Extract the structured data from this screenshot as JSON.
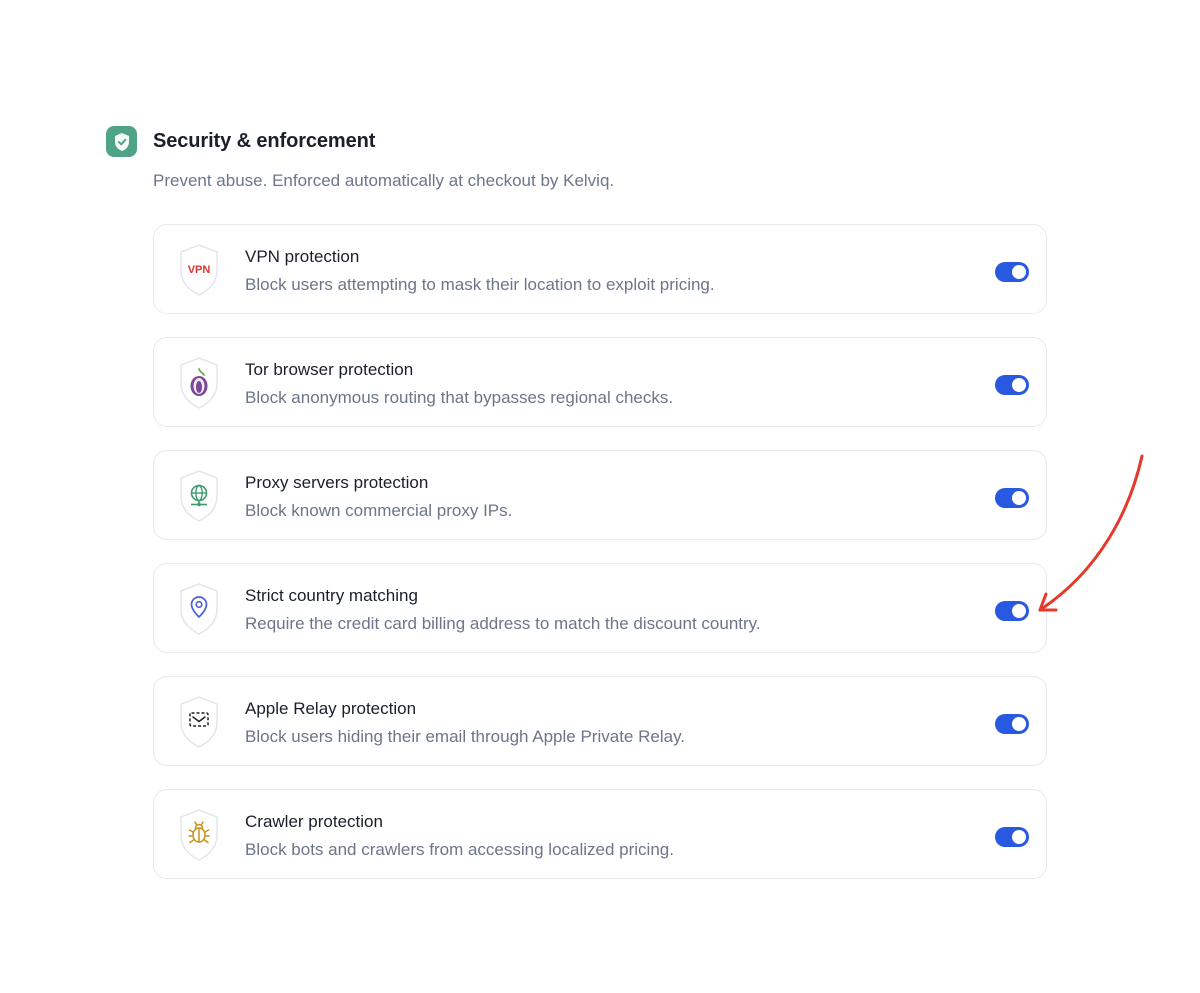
{
  "section": {
    "title": "Security & enforcement",
    "subtitle": "Prevent abuse. Enforced automatically at checkout by Kelviq.",
    "icon": "shield-check-icon"
  },
  "items": [
    {
      "title": "VPN protection",
      "description": "Block users attempting to mask their location to exploit pricing.",
      "icon": "vpn-shield-icon",
      "icon_text": "VPN",
      "enabled": true
    },
    {
      "title": "Tor browser protection",
      "description": "Block anonymous routing that bypasses regional checks.",
      "icon": "tor-onion-icon",
      "enabled": true
    },
    {
      "title": "Proxy servers protection",
      "description": "Block known commercial proxy IPs.",
      "icon": "globe-network-icon",
      "enabled": true
    },
    {
      "title": "Strict country matching",
      "description": "Require the credit card billing address to match the discount country.",
      "icon": "location-pin-icon",
      "enabled": true
    },
    {
      "title": "Apple Relay protection",
      "description": "Block users hiding their email through Apple Private Relay.",
      "icon": "hidden-mail-icon",
      "enabled": true
    },
    {
      "title": "Crawler protection",
      "description": "Block bots and crawlers from accessing localized pricing.",
      "icon": "bug-icon",
      "enabled": true
    }
  ],
  "colors": {
    "accent": "#2859e0",
    "section_icon": "#4fa386",
    "annotation_arrow": "#e53a2b"
  }
}
